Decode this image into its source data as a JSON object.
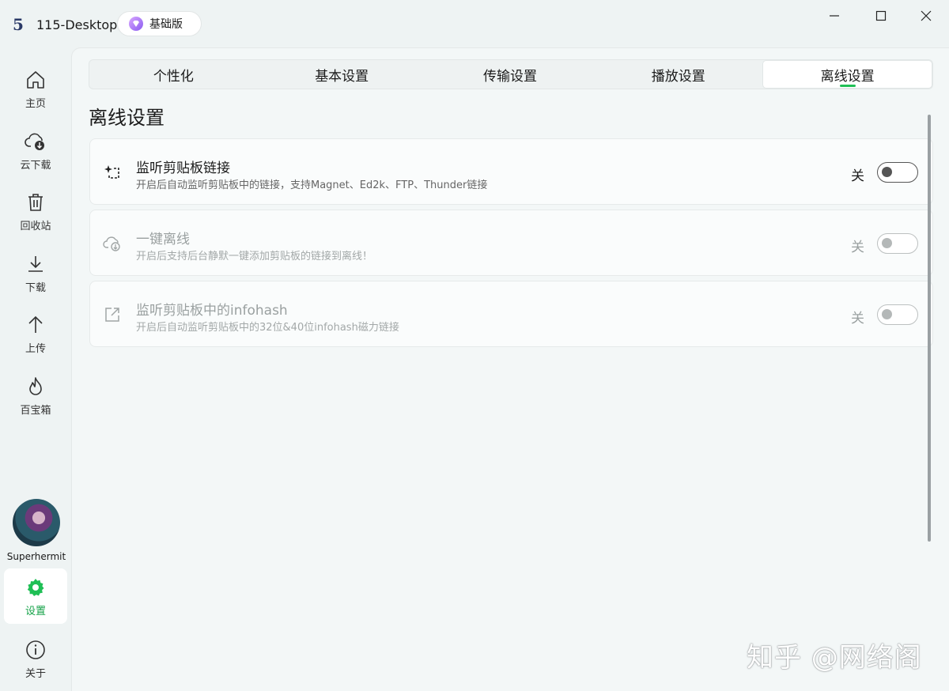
{
  "app": {
    "logo_char": "5",
    "title": "115-Desktop",
    "edition": "基础版"
  },
  "sidebar": {
    "items": [
      {
        "id": "home",
        "label": "主页",
        "icon": "home-icon"
      },
      {
        "id": "cloud-download",
        "label": "云下载",
        "icon": "cloud-download-icon"
      },
      {
        "id": "recycle",
        "label": "回收站",
        "icon": "trash-icon"
      },
      {
        "id": "download",
        "label": "下载",
        "icon": "download-icon"
      },
      {
        "id": "upload",
        "label": "上传",
        "icon": "upload-icon"
      },
      {
        "id": "toolbox",
        "label": "百宝箱",
        "icon": "flame-icon"
      }
    ],
    "username": "Superhermit",
    "settings": {
      "label": "设置",
      "icon": "gear-icon"
    },
    "about": {
      "label": "关于",
      "icon": "info-icon"
    }
  },
  "tabs": [
    {
      "label": "个性化",
      "active": false
    },
    {
      "label": "基本设置",
      "active": false
    },
    {
      "label": "传输设置",
      "active": false
    },
    {
      "label": "播放设置",
      "active": false
    },
    {
      "label": "离线设置",
      "active": true
    }
  ],
  "section": {
    "title": "离线设置",
    "settings": [
      {
        "title": "监听剪贴板链接",
        "description": "开启后自动监听剪贴板中的链接，支持Magnet、Ed2k、FTP、Thunder链接",
        "state": "关",
        "enabled": true,
        "icon": "sparkle-select-icon"
      },
      {
        "title": "一键离线",
        "description": "开启后支持后台静默一键添加剪贴板的链接到离线！",
        "state": "关",
        "enabled": false,
        "icon": "cloud-download-icon"
      },
      {
        "title": "监听剪贴板中的infohash",
        "description": "开启后自动监听剪贴板中的32位&40位infohash磁力链接",
        "state": "关",
        "enabled": false,
        "icon": "external-link-icon"
      }
    ]
  },
  "watermark": "知乎 @网络阁",
  "colors": {
    "accent": "#1fbf55",
    "background": "#eef3f3"
  }
}
